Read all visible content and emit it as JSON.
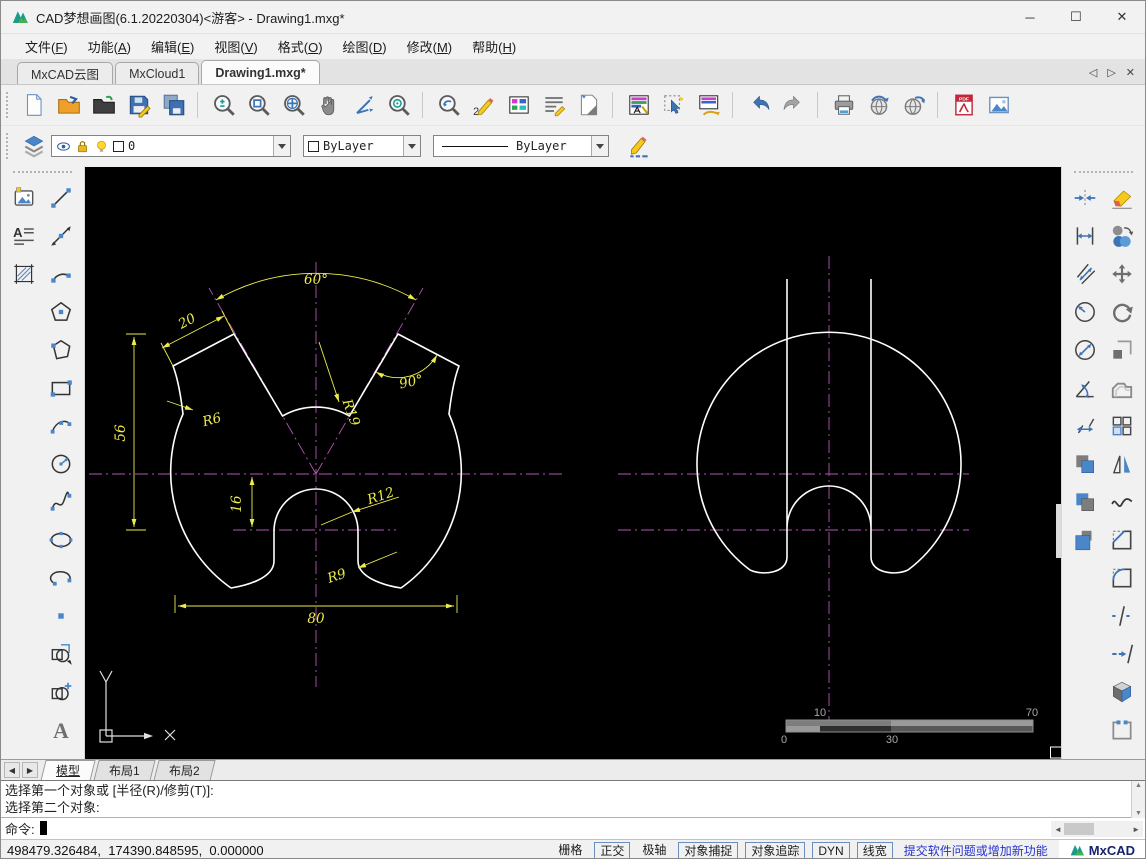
{
  "window": {
    "title": "CAD梦想画图(6.1.20220304)<游客> - Drawing1.mxg*",
    "controls": {
      "minimize": "─",
      "maximize": "☐",
      "close": "✕"
    }
  },
  "menu": {
    "items": [
      {
        "name": "menu-file",
        "pre": "文件(",
        "key": "F",
        "post": ")"
      },
      {
        "name": "menu-function",
        "pre": "功能(",
        "key": "A",
        "post": ")"
      },
      {
        "name": "menu-edit",
        "pre": "编辑(",
        "key": "E",
        "post": ")"
      },
      {
        "name": "menu-view",
        "pre": "视图(",
        "key": "V",
        "post": ")"
      },
      {
        "name": "menu-format",
        "pre": "格式(",
        "key": "O",
        "post": ")"
      },
      {
        "name": "menu-draw",
        "pre": "绘图(",
        "key": "D",
        "post": ")"
      },
      {
        "name": "menu-modify",
        "pre": "修改(",
        "key": "M",
        "post": ")"
      },
      {
        "name": "menu-help",
        "pre": "帮助(",
        "key": "H",
        "post": ")"
      }
    ]
  },
  "doc_tabs": {
    "items": [
      {
        "name": "tab-mxcad-cloud",
        "label": "MxCAD云图",
        "active": false
      },
      {
        "name": "tab-mxcloud1",
        "label": "MxCloud1",
        "active": false
      },
      {
        "name": "tab-drawing1",
        "label": "Drawing1.mxg*",
        "active": true
      }
    ],
    "controls": {
      "prev": "◁",
      "next": "▷",
      "close": "✕"
    }
  },
  "toolbar_main": {
    "items": [
      {
        "name": "new-file",
        "icon": "page"
      },
      {
        "name": "open-drawing",
        "icon": "foldero"
      },
      {
        "name": "open-folder",
        "icon": "folderd"
      },
      {
        "name": "save",
        "icon": "floppy"
      },
      {
        "name": "save-as",
        "icon": "floppy2"
      },
      {
        "name": "zoom-extents",
        "icon": "magpm",
        "sep": true
      },
      {
        "name": "zoom-window",
        "icon": "magwin"
      },
      {
        "name": "zoom-all",
        "icon": "magall"
      },
      {
        "name": "pan",
        "icon": "hand"
      },
      {
        "name": "ucs-axes",
        "icon": "axes"
      },
      {
        "name": "zoom-center",
        "icon": "magc"
      },
      {
        "name": "view-previous",
        "icon": "magback",
        "sep": true
      },
      {
        "name": "sketch",
        "icon": "pencil2"
      },
      {
        "name": "color-palette",
        "icon": "palette"
      },
      {
        "name": "text-style",
        "icon": "textlines"
      },
      {
        "name": "layout-page",
        "icon": "pagefold"
      },
      {
        "name": "layer-manager",
        "icon": "layermgr",
        "sep": true
      },
      {
        "name": "quick-select",
        "icon": "select"
      },
      {
        "name": "match-properties",
        "icon": "match"
      },
      {
        "name": "undo",
        "icon": "undo",
        "sep": true
      },
      {
        "name": "redo",
        "icon": "redo"
      },
      {
        "name": "print",
        "icon": "printer",
        "sep": true
      },
      {
        "name": "publish-web",
        "icon": "globeup"
      },
      {
        "name": "open-web",
        "icon": "globert"
      },
      {
        "name": "export-pdf",
        "icon": "pdf",
        "sep": true
      },
      {
        "name": "insert-raster-image",
        "icon": "image"
      }
    ]
  },
  "props": {
    "layer_value": "0",
    "color_value": "ByLayer",
    "linetype_value": "ByLayer"
  },
  "left_toolbar": {
    "col1": [
      {
        "name": "image-tool",
        "icon": "imgframe"
      },
      {
        "name": "mtext-tool",
        "icon": "mtext"
      },
      {
        "name": "hatch-tool",
        "icon": "hatch"
      }
    ],
    "col2": [
      {
        "name": "line-tool",
        "icon": "line"
      },
      {
        "name": "xline-tool",
        "icon": "xline"
      },
      {
        "name": "arc-tool",
        "icon": "arc"
      },
      {
        "name": "polygon-tool",
        "icon": "polygon"
      },
      {
        "name": "polyline-tool",
        "icon": "polyline"
      },
      {
        "name": "rectangle-tool",
        "icon": "rect"
      },
      {
        "name": "arc-3pt-tool",
        "icon": "arc3"
      },
      {
        "name": "circle-tool",
        "icon": "circle"
      },
      {
        "name": "spline-tool",
        "icon": "spline"
      },
      {
        "name": "ellipse-tool",
        "icon": "ellipse"
      },
      {
        "name": "ellipse-arc-tool",
        "icon": "earc"
      },
      {
        "name": "point-tool",
        "icon": "point"
      },
      {
        "name": "region-tool",
        "icon": "region"
      },
      {
        "name": "block-insert-tool",
        "icon": "blockplus"
      },
      {
        "name": "text-tool",
        "icon": "bigA"
      }
    ]
  },
  "right_toolbar": {
    "col1": [
      {
        "name": "edge-trim",
        "icon": "conv"
      },
      {
        "name": "dim-linear",
        "icon": "dlin"
      },
      {
        "name": "dim-aligned",
        "icon": "dali"
      },
      {
        "name": "dim-radius",
        "icon": "drad"
      },
      {
        "name": "dim-diameter",
        "icon": "ddia"
      },
      {
        "name": "dim-angular",
        "icon": "dang"
      },
      {
        "name": "dim-baseline",
        "icon": "dbase"
      },
      {
        "name": "draw-order-front",
        "icon": "osq"
      },
      {
        "name": "draw-order-back",
        "icon": "osq2"
      },
      {
        "name": "draw-order-under",
        "icon": "osq3"
      }
    ],
    "col2": [
      {
        "name": "erase",
        "icon": "eraser"
      },
      {
        "name": "copy",
        "icon": "copy"
      },
      {
        "name": "move",
        "icon": "move"
      },
      {
        "name": "rotate",
        "icon": "rotate"
      },
      {
        "name": "scale",
        "icon": "scalec"
      },
      {
        "name": "offset",
        "icon": "offset"
      },
      {
        "name": "array",
        "icon": "array"
      },
      {
        "name": "mirror",
        "icon": "mirror"
      },
      {
        "name": "revision-curve",
        "icon": "curve"
      },
      {
        "name": "chamfer",
        "icon": "chamfer"
      },
      {
        "name": "fillet",
        "icon": "fillet"
      },
      {
        "name": "break",
        "icon": "breaks"
      },
      {
        "name": "lengthen",
        "icon": "lengthen"
      },
      {
        "name": "view-3d",
        "icon": "box3d"
      },
      {
        "name": "group",
        "icon": "closeg"
      }
    ]
  },
  "canvas": {
    "dims": {
      "d60": "60°",
      "d20": "20",
      "d56": "56",
      "d16": "16",
      "d80": "80",
      "r6": "R6",
      "r19": "R19",
      "a90": "90°",
      "r12": "R12",
      "r9": "R9"
    },
    "scalebar": {
      "t10": "10",
      "t70": "70",
      "b0": "0",
      "b30": "30"
    }
  },
  "layout_tabs": {
    "items": [
      {
        "name": "layout-tab-model",
        "label": "模型",
        "active": true
      },
      {
        "name": "layout-tab-1",
        "label": "布局1",
        "active": false
      },
      {
        "name": "layout-tab-2",
        "label": "布局2",
        "active": false
      }
    ],
    "controls": {
      "prev": "◀",
      "next": "▶"
    }
  },
  "command": {
    "history": [
      "选择第一个对象或 [半径(R)/修剪(T)]:",
      "选择第二个对象:"
    ],
    "prompt": "命令:",
    "scroll": {
      "left": "◄",
      "right": "►",
      "up": "▲",
      "down": "▼"
    }
  },
  "statusbar": {
    "coordinates": "498479.326484,  174390.848595,  0.000000",
    "toggles": [
      {
        "label": "栅格",
        "boxed": false
      },
      {
        "label": "正交",
        "boxed": true
      },
      {
        "label": "极轴",
        "boxed": false
      },
      {
        "label": "对象捕捉",
        "boxed": true
      },
      {
        "label": "对象追踪",
        "boxed": true
      },
      {
        "label": "DYN",
        "boxed": true
      },
      {
        "label": "线宽",
        "boxed": true
      }
    ],
    "link": "提交软件问题或增加新功能",
    "brand": "MxCAD"
  }
}
